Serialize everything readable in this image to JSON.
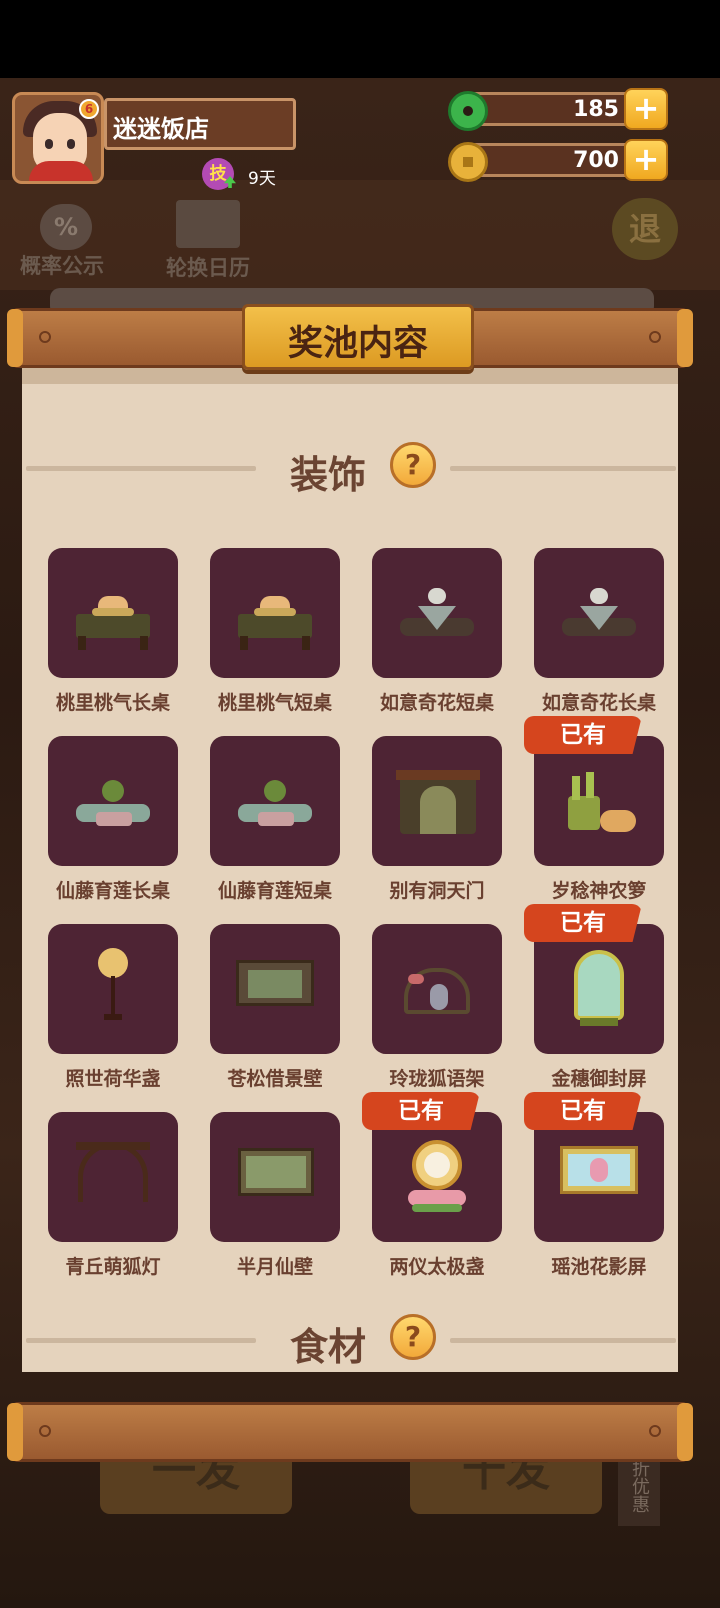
{
  "header": {
    "shop_name": "迷迷饭店",
    "skill_label": "技",
    "days": "9天",
    "avatar_badge": "6",
    "jade_count": "185",
    "coin_count": "700",
    "plus_label": "+"
  },
  "background": {
    "rate_label": "概率公示",
    "rate_icon": "%",
    "calendar_label": "轮换日历",
    "exit_label": "退",
    "bottom_btn_left": "一发",
    "bottom_btn_right": "十发",
    "side_tag": "九折优惠"
  },
  "modal": {
    "title": "奖池内容",
    "sections": [
      {
        "title": "装饰",
        "help": "?"
      },
      {
        "title": "食材",
        "help": "?"
      }
    ],
    "owned_label": "已有",
    "items": [
      {
        "name": "桃里桃气长桌",
        "owned": false,
        "icon": "peach-long-table-icon"
      },
      {
        "name": "桃里桃气短桌",
        "owned": false,
        "icon": "peach-short-table-icon"
      },
      {
        "name": "如意奇花短桌",
        "owned": false,
        "icon": "ruyi-short-table-icon"
      },
      {
        "name": "如意奇花长桌",
        "owned": false,
        "icon": "ruyi-long-table-icon"
      },
      {
        "name": "仙藤育莲长桌",
        "owned": false,
        "icon": "lotus-long-table-icon"
      },
      {
        "name": "仙藤育莲短桌",
        "owned": false,
        "icon": "lotus-short-table-icon"
      },
      {
        "name": "别有洞天门",
        "owned": false,
        "icon": "gate-icon"
      },
      {
        "name": "岁稔神农箩",
        "owned": true,
        "icon": "harvest-basket-icon"
      },
      {
        "name": "照世荷华盏",
        "owned": false,
        "icon": "lotus-lamp-icon"
      },
      {
        "name": "苍松借景壁",
        "owned": false,
        "icon": "pine-wall-icon"
      },
      {
        "name": "玲珑狐语架",
        "owned": false,
        "icon": "fox-shelf-icon"
      },
      {
        "name": "金穗御封屏",
        "owned": true,
        "icon": "golden-screen-icon"
      },
      {
        "name": "青丘萌狐灯",
        "owned": false,
        "icon": "fox-lamp-arch-icon"
      },
      {
        "name": "半月仙壁",
        "owned": false,
        "icon": "half-moon-wall-icon"
      },
      {
        "name": "两仪太极盏",
        "owned": true,
        "icon": "taiji-lamp-icon"
      },
      {
        "name": "瑶池花影屏",
        "owned": true,
        "icon": "flower-screen-icon"
      }
    ]
  }
}
